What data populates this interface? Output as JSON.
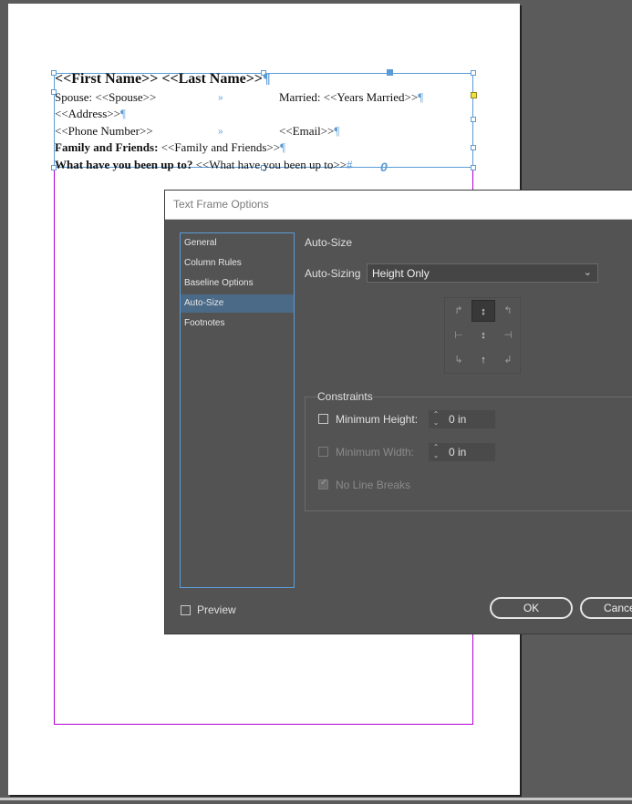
{
  "document": {
    "line1": "<<First Name>> <<Last Name>>",
    "pilcrow": "¶",
    "line2_left": "Spouse: <<Spouse>>",
    "tab_mark": "»",
    "line2_right": "Married: <<Years Married>>",
    "line3": "<<Address>>",
    "line4_left": "<<Phone Number>>",
    "line4_right": "<<Email>>",
    "line5_bold": "Family and Friends:",
    "line5_rest": " <<Family and Friends>>",
    "line6_bold": "What have you been up to?",
    "line6_rest": " <<What have you been up to>>",
    "line6_end": "#",
    "overset_marker": "0"
  },
  "dialog": {
    "title": "Text Frame Options",
    "nav": [
      "General",
      "Column Rules",
      "Baseline Options",
      "Auto-Size",
      "Footnotes"
    ],
    "selected_nav": "Auto-Size",
    "section_title": "Auto-Size",
    "auto_sizing_label": "Auto-Sizing",
    "auto_sizing_value": "Height Only",
    "constraints_legend": "Constraints",
    "min_height_label": "Minimum Height:",
    "min_height_value": "0 in",
    "min_width_label": "Minimum Width:",
    "min_width_value": "0 in",
    "no_line_breaks_label": "No Line Breaks",
    "preview_label": "Preview",
    "ok_label": "OK",
    "cancel_label": "Cance"
  },
  "colors": {
    "frame": "#5b9bd5",
    "margin_guide": "#b000d0",
    "dialog_bg": "#535353",
    "selection": "#4b6a88"
  }
}
